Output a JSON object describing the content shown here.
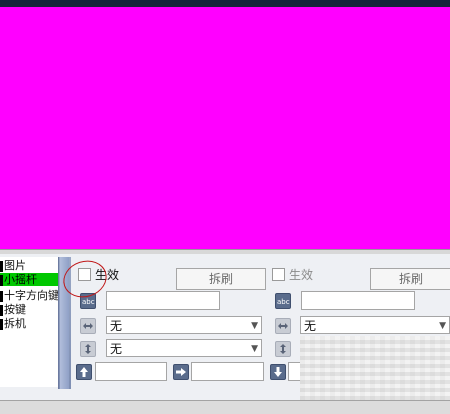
{
  "sidebar": {
    "items": [
      {
        "label": "图片"
      },
      {
        "label": "小摇杆"
      },
      {
        "label": "十字方向键"
      },
      {
        "label": "按键"
      },
      {
        "label": "拆机"
      }
    ]
  },
  "left_group": {
    "enable_label": "生效",
    "bind_button": "拆刷",
    "horizontal_value": "无",
    "vertical_value": "无"
  },
  "right_group": {
    "enable_label": "生效",
    "bind_button": "拆刷",
    "horizontal_value": "无"
  },
  "colors": {
    "preview_bg": "#ff00ff",
    "selection": "#00c800",
    "annotation": "#c01818"
  },
  "icons": [
    "abc-icon",
    "horizontal-arrows-icon",
    "vertical-arrows-icon",
    "arrow-up-icon",
    "arrow-right-icon",
    "arrow-down-icon"
  ]
}
